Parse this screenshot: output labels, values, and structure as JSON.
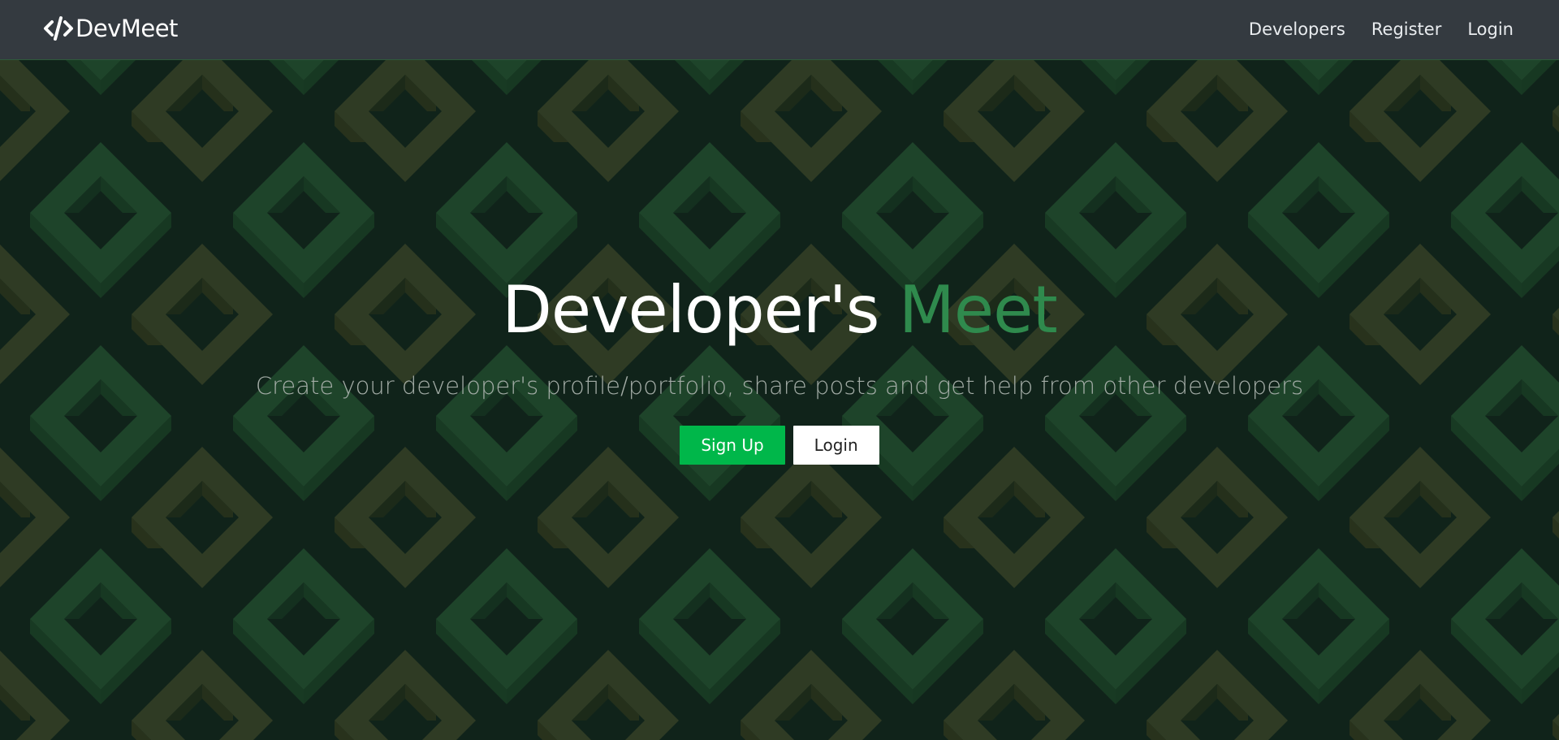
{
  "navbar": {
    "brand": "DevMeet",
    "links": [
      "Developers",
      "Register",
      "Login"
    ]
  },
  "hero": {
    "title_main": "Developer's",
    "title_accent": "Meet",
    "subtitle": "Create your developer's profile/portfolio, share posts and get help from other developers",
    "primary_button": "Sign Up",
    "secondary_button": "Login"
  },
  "colors": {
    "navbar_bg": "#343a40",
    "hero_bg": "#10231a",
    "pattern_green": "#1e442a",
    "pattern_olive": "#2f3b24",
    "accent": "#2f8a4d",
    "primary_button": "#00b74a"
  },
  "icons": {
    "brand": "code-icon"
  }
}
